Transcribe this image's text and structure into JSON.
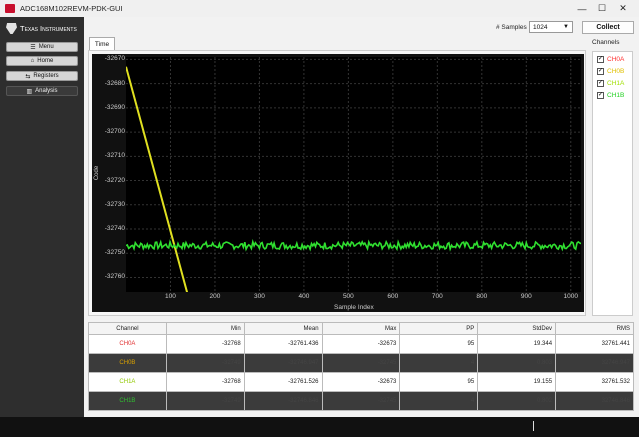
{
  "window": {
    "title": "ADC168M102REVM-PDK-GUI",
    "controls": {
      "minimize": "—",
      "maximize": "☐",
      "close": "✕"
    }
  },
  "sidebar": {
    "logo_text": "Texas Instruments",
    "items": [
      {
        "label": "Menu",
        "icon": "hamburger-icon",
        "glyph": "☰"
      },
      {
        "label": "Home",
        "icon": "home-icon",
        "glyph": "⌂"
      },
      {
        "label": "Registers",
        "icon": "registers-icon",
        "glyph": "⇆"
      },
      {
        "label": "Analysis",
        "icon": "bar-chart-icon",
        "glyph": "▥"
      }
    ]
  },
  "toolbar": {
    "samples_label": "# Samples",
    "samples_value": "1024",
    "collect_label": "Collect"
  },
  "tabs": [
    {
      "label": "Time"
    }
  ],
  "channels": {
    "title": "Channels",
    "items": [
      {
        "label": "CH0A",
        "checked": true,
        "color": "#ff3030"
      },
      {
        "label": "CH0B",
        "checked": true,
        "color": "#e0c000"
      },
      {
        "label": "CH1A",
        "checked": true,
        "color": "#a0e000"
      },
      {
        "label": "CH1B",
        "checked": true,
        "color": "#20d020"
      }
    ]
  },
  "chart_data": {
    "type": "line",
    "xlabel": "Sample Index",
    "ylabel": "Code",
    "xlim": [
      0,
      1023
    ],
    "ylim": [
      -32766,
      -32669
    ],
    "xticks": [
      100,
      200,
      300,
      400,
      500,
      600,
      700,
      800,
      900,
      1000
    ],
    "yticks": [
      -32670,
      -32680,
      -32690,
      -32700,
      -32710,
      -32720,
      -32730,
      -32740,
      -32750,
      -32760
    ],
    "background": "#000000",
    "series": [
      {
        "name": "CH0B",
        "color": "#e0e020",
        "x": [
          0,
          140,
          141,
          1023
        ],
        "y": [
          -32673,
          -32768,
          -32768,
          -32768
        ]
      },
      {
        "name": "CH1B",
        "color": "#30e030",
        "x": [
          0,
          1023
        ],
        "y": [
          -32746.8,
          -32746.8
        ],
        "noise": 1.5
      }
    ]
  },
  "stats": {
    "headers": [
      "Channel",
      "Min",
      "Mean",
      "Max",
      "PP",
      "StdDev",
      "RMS"
    ],
    "rows": [
      {
        "channel": "CH0A",
        "color": "#e03030",
        "style": "light",
        "min": "-32768",
        "mean": "-32761.436",
        "max": "-32673",
        "pp": "95",
        "stddev": "19.344",
        "rms": "32761.441"
      },
      {
        "channel": "CH0B",
        "color": "#d8a000",
        "style": "dark",
        "min": "-32749",
        "mean": "-32746.947",
        "max": "-32745",
        "pp": "4",
        "stddev": "0.803",
        "rms": "32746.947"
      },
      {
        "channel": "CH1A",
        "color": "#90c800",
        "style": "light",
        "min": "-32768",
        "mean": "-32761.526",
        "max": "-32673",
        "pp": "95",
        "stddev": "19.155",
        "rms": "32761.532"
      },
      {
        "channel": "CH1B",
        "color": "#30c030",
        "style": "dark",
        "min": "-32749",
        "mean": "-32746.846",
        "max": "-32745",
        "pp": "4",
        "stddev": "0.802",
        "rms": "32746.846"
      }
    ]
  }
}
